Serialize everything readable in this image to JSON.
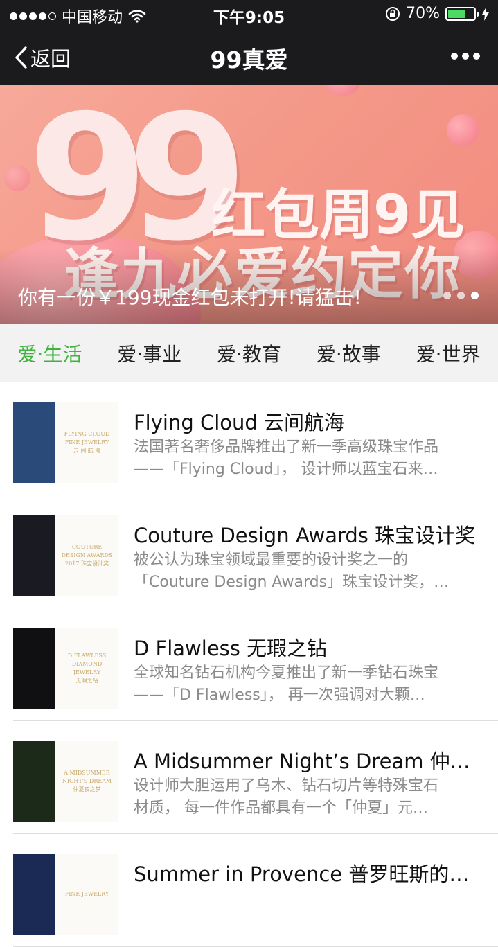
{
  "status_bar": {
    "carrier": "中国移动",
    "time": "下午9:05",
    "battery": "70%",
    "battery_level": 0.7
  },
  "nav": {
    "back_label": "返回",
    "title": "99真爱"
  },
  "banner": {
    "big_text": "99",
    "line1": "红包周9见",
    "line2": "逢九必爱约定你",
    "caption": "你有一份￥199现金红包未打开!请猛击!",
    "page_count": 3,
    "active_page": 2
  },
  "tabs": [
    {
      "label": "爱·生活",
      "active": true
    },
    {
      "label": "爱·事业",
      "active": false
    },
    {
      "label": "爱·教育",
      "active": false
    },
    {
      "label": "爱·故事",
      "active": false
    },
    {
      "label": "爱·世界",
      "active": false
    }
  ],
  "articles": [
    {
      "title": "Flying Cloud 云间航海",
      "desc_line1": "法国著名奢侈品牌推出了新一季高级珠宝作品",
      "desc_line2": "——「Flying Cloud」， 设计师以蓝宝石来…",
      "thumb_label": "FLYING CLOUD\nFINE JEWELRY\n云 间 航 海",
      "thumb_color": "#2a4a7a"
    },
    {
      "title": "Couture Design Awards 珠宝设计奖",
      "desc_line1": "被公认为珠宝领域最重要的设计奖之一的",
      "desc_line2": "「Couture Design Awards」珠宝设计奖，…",
      "thumb_label": "COUTURE\nDESIGN AWARDS\n2017 珠宝设计奖",
      "thumb_color": "#1a1a22"
    },
    {
      "title": "D Flawless 无瑕之钻",
      "desc_line1": "全球知名钻石机构今夏推出了新一季钻石珠宝",
      "desc_line2": "——「D Flawless」， 再一次强调对大颗…",
      "thumb_label": "D FLAWLESS\nDIAMOND JEWELRY\n无瑕之钻",
      "thumb_color": "#101012"
    },
    {
      "title": "A Midsummer Night’s Dream 仲夏…",
      "desc_line1": "设计师大胆运用了乌木、钻石切片等特殊宝石",
      "desc_line2": "材质， 每一件作品都具有一个「仲夏」元…",
      "thumb_label": "A MIDSUMMER\nNIGHT'S DREAM\n仲夏夜之梦",
      "thumb_color": "#1c2a1a"
    },
    {
      "title": "Summer in Provence 普罗旺斯的…",
      "desc_line1": "",
      "desc_line2": "",
      "thumb_label": "FINE JEWELRY",
      "thumb_color": "#1a2a55"
    }
  ]
}
